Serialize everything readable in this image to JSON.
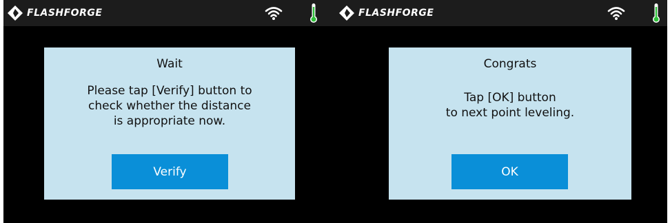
{
  "brand": "FLASHFORGE",
  "colors": {
    "accent_button": "#0a8fd8",
    "dialog_bg": "#c6e3ef",
    "thermometer": "#2fbf3a",
    "topbar": "#1c1c1c"
  },
  "icons": {
    "logo": "flashforge-logo-icon",
    "wifi": "wifi-icon",
    "temperature": "thermometer-icon"
  },
  "screens": [
    {
      "dialog": {
        "title": "Wait",
        "message_lines": [
          "Please tap [Verify] button to",
          "check whether the distance",
          "is appropriate now."
        ],
        "button_label": "Verify"
      }
    },
    {
      "dialog": {
        "title": "Congrats",
        "message_lines": [
          "Tap [OK] button",
          "to next point leveling."
        ],
        "button_label": "OK"
      }
    }
  ]
}
